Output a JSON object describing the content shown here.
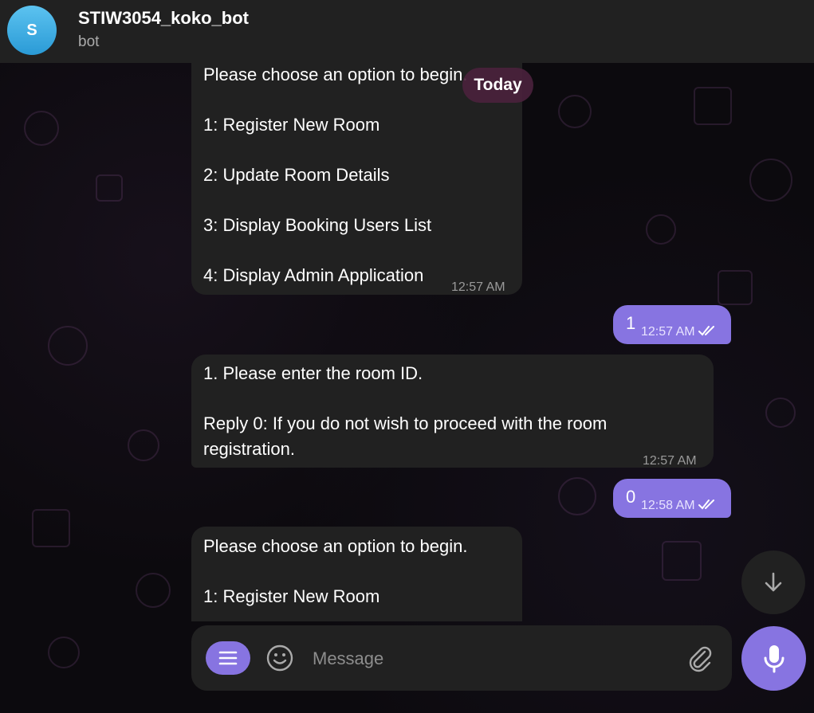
{
  "header": {
    "avatar_letter": "S",
    "title": "STIW3054_koko_bot",
    "subtitle": "bot"
  },
  "date_badge": "Today",
  "messages": [
    {
      "lines": [
        "Please choose an option to begin.",
        "1: Register New Room",
        "2: Update Room Details",
        "3: Display Booking Users List",
        "4: Display Admin Application"
      ],
      "time": "12:57 AM"
    },
    {
      "text": "1",
      "time": "12:57 AM"
    },
    {
      "lines": [
        "1. Please enter the room ID.",
        "Reply 0: If you do not wish to proceed with the room",
        "registration."
      ],
      "time": "12:57 AM"
    },
    {
      "text": "0",
      "time": "12:58 AM"
    },
    {
      "lines": [
        "Please choose an option to begin.",
        "1: Register New Room"
      ]
    }
  ],
  "composer": {
    "placeholder": "Message"
  },
  "icons": {
    "menu": "menu-icon",
    "emoji": "emoji-icon",
    "attach": "paperclip-icon",
    "mic": "microphone-icon",
    "scroll": "arrow-down-icon",
    "read": "double-check-icon"
  },
  "colors": {
    "accent": "#8774e1",
    "bubble_in": "#212121",
    "header": "#212121",
    "date_badge": "#4a223c"
  }
}
